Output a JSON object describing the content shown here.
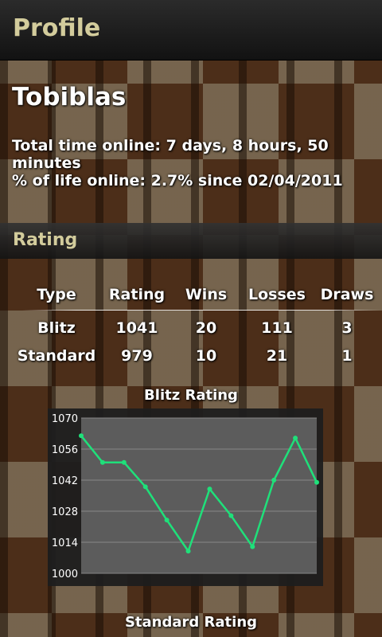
{
  "title_bar": {
    "title": "Profile"
  },
  "profile": {
    "username": "Tobiblas",
    "time_online": "Total time online: 7 days, 8 hours, 50 minutes",
    "life_online": "% of life online: 2.7% since 02/04/2011"
  },
  "rating_section": {
    "header": "Rating",
    "columns": [
      "Type",
      "Rating",
      "Wins",
      "Losses",
      "Draws"
    ],
    "rows": [
      [
        "Blitz",
        "1041",
        "20",
        "111",
        "3"
      ],
      [
        "Standard",
        "979",
        "10",
        "21",
        "1"
      ]
    ]
  },
  "charts": {
    "blitz_title": "Blitz Rating",
    "standard_title": "Standard Rating"
  },
  "colors": {
    "title_text": "#d3cc9c",
    "line": "#1fe07a",
    "plot_bg": "#5c5c5c",
    "grid": "#888888"
  },
  "chart_data": {
    "type": "line",
    "title": "Blitz Rating",
    "xlabel": "",
    "ylabel": "",
    "ylim": [
      1000,
      1070
    ],
    "yticks": [
      1000,
      1014,
      1028,
      1042,
      1056,
      1070
    ],
    "grid": true,
    "series": [
      {
        "values": [
          1062,
          1050,
          1050,
          1039,
          1024,
          1010,
          1038,
          1026,
          1012,
          1042,
          1061,
          1041
        ]
      }
    ]
  }
}
